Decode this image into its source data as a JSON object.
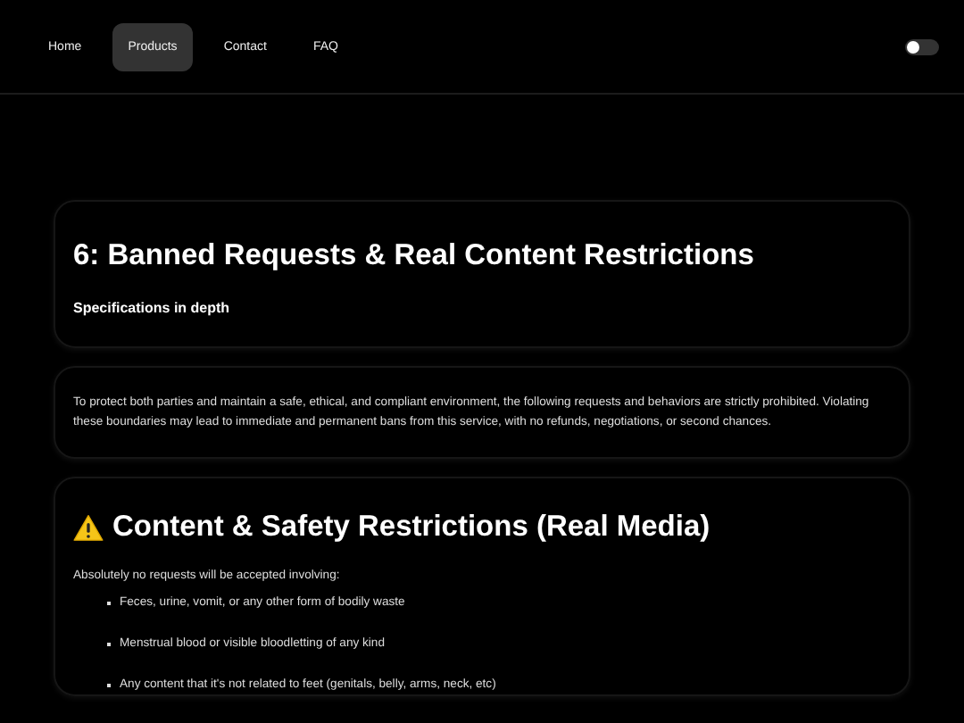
{
  "nav": {
    "items": [
      {
        "label": "Home",
        "selected": false
      },
      {
        "label": "Products",
        "selected": true
      },
      {
        "label": "Contact",
        "selected": false
      },
      {
        "label": "FAQ",
        "selected": false
      }
    ],
    "theme_toggle": {
      "on": false
    }
  },
  "header_card": {
    "title": "6: Banned Requests & Real Content Restrictions",
    "subtitle": "Specifications in depth"
  },
  "intro_card": {
    "text": "To protect both parties and maintain a safe, ethical, and compliant environment, the following requests and behaviors are strictly prohibited. Violating these boundaries may lead to immediate and permanent bans from this service, with no refunds, negotiations, or second chances."
  },
  "section": {
    "title": "Content & Safety Restrictions (Real Media)",
    "lead": "Absolutely no requests will be accepted involving:",
    "items": [
      "Feces, urine, vomit, or any other form of bodily waste",
      "Menstrual blood or visible bloodletting of any kind",
      "Any content that it's not related to feet (genitals, belly, arms, neck, etc)"
    ]
  }
}
